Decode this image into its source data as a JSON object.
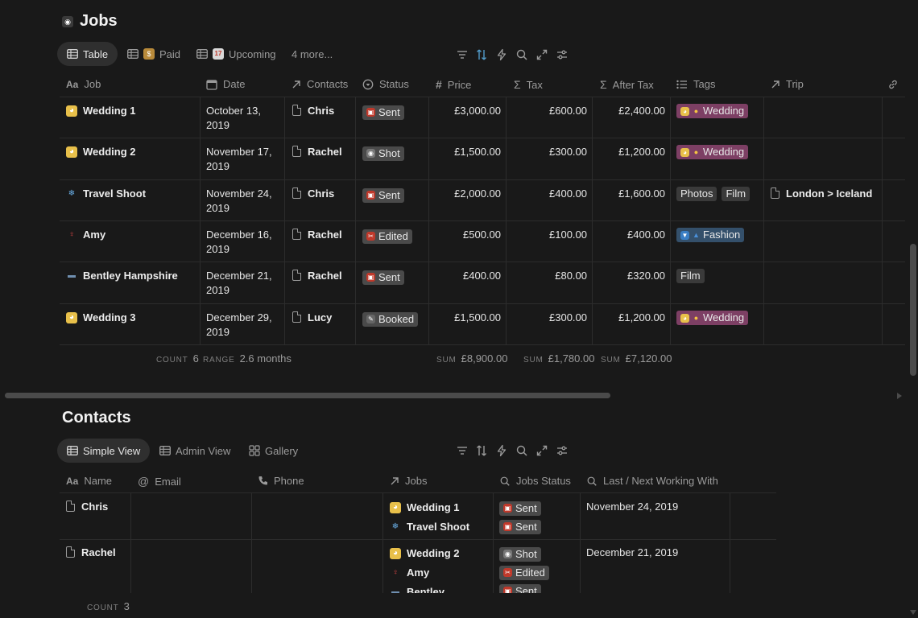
{
  "jobs": {
    "title": "Jobs",
    "icon": "camera-flash-icon",
    "tabs": [
      {
        "label": "Table",
        "icon": "table-icon",
        "emoji": ""
      },
      {
        "label": "Paid",
        "icon": "table-icon",
        "emoji": "money-bag-icon"
      },
      {
        "label": "Upcoming",
        "icon": "table-icon",
        "emoji": "calendar-icon"
      }
    ],
    "more_tabs": "4 more...",
    "columns": [
      "Job",
      "Date",
      "Contacts",
      "Status",
      "Price",
      "Tax",
      "After Tax",
      "Tags",
      "Trip"
    ],
    "rows": [
      {
        "icon": "bride-icon",
        "job": "Wedding 1",
        "date1": "October 13,",
        "date2": "2019",
        "contact": "Chris",
        "status": "Sent",
        "price": "£3,000.00",
        "tax": "£600.00",
        "after_tax": "£2,400.00",
        "tags": [
          {
            "label": "Wedding",
            "color": "pink",
            "emoji": true
          }
        ],
        "trip": ""
      },
      {
        "icon": "bride-icon",
        "job": "Wedding 2",
        "date1": "November 17,",
        "date2": "2019",
        "contact": "Rachel",
        "status": "Shot",
        "price": "£1,500.00",
        "tax": "£300.00",
        "after_tax": "£1,200.00",
        "tags": [
          {
            "label": "Wedding",
            "color": "pink",
            "emoji": true
          }
        ],
        "trip": ""
      },
      {
        "icon": "snowflake-icon",
        "job": "Travel Shoot",
        "date1": "November 24,",
        "date2": "2019",
        "contact": "Chris",
        "status": "Sent",
        "price": "£2,000.00",
        "tax": "£400.00",
        "after_tax": "£1,600.00",
        "tags": [
          {
            "label": "Photos",
            "color": "gray",
            "emoji": false
          },
          {
            "label": "Film",
            "color": "gray",
            "emoji": false
          }
        ],
        "trip": "London > Iceland"
      },
      {
        "icon": "dancer-icon",
        "job": "Amy",
        "date1": "December 16,",
        "date2": "2019",
        "contact": "Rachel",
        "status": "Edited",
        "price": "£500.00",
        "tax": "£100.00",
        "after_tax": "£400.00",
        "tags": [
          {
            "label": "Fashion",
            "color": "blue",
            "emoji": true
          }
        ],
        "trip": ""
      },
      {
        "icon": "car-icon",
        "job": "Bentley Hampshire",
        "date1": "December 21,",
        "date2": "2019",
        "contact": "Rachel",
        "status": "Sent",
        "price": "£400.00",
        "tax": "£80.00",
        "after_tax": "£320.00",
        "tags": [
          {
            "label": "Film",
            "color": "gray",
            "emoji": false
          }
        ],
        "trip": ""
      },
      {
        "icon": "bride-icon",
        "job": "Wedding 3",
        "date1": "December 29,",
        "date2": "2019",
        "contact": "Lucy",
        "status": "Booked",
        "price": "£1,500.00",
        "tax": "£300.00",
        "after_tax": "£1,200.00",
        "tags": [
          {
            "label": "Wedding",
            "color": "pink",
            "emoji": true
          }
        ],
        "trip": ""
      }
    ],
    "footer": {
      "count_label": "COUNT",
      "count": "6",
      "range_label": "RANGE",
      "range": "2.6 months",
      "sum_label": "SUM",
      "price_sum": "£8,900.00",
      "tax_sum": "£1,780.00",
      "after_tax_sum": "£7,120.00"
    }
  },
  "contacts": {
    "title": "Contacts",
    "tabs": [
      {
        "label": "Simple View",
        "icon": "table-icon"
      },
      {
        "label": "Admin View",
        "icon": "table-icon"
      },
      {
        "label": "Gallery",
        "icon": "gallery-icon"
      }
    ],
    "columns": [
      "Name",
      "Email",
      "Phone",
      "Jobs",
      "Jobs Status",
      "Last / Next Working With"
    ],
    "rows": [
      {
        "name": "Chris",
        "jobs": [
          {
            "icon": "bride-icon",
            "label": "Wedding 1"
          },
          {
            "icon": "snowflake-icon",
            "label": "Travel Shoot"
          }
        ],
        "statuses": [
          "Sent",
          "Sent"
        ],
        "last_next": "November 24, 2019"
      },
      {
        "name": "Rachel",
        "jobs": [
          {
            "icon": "bride-icon",
            "label": "Wedding 2"
          },
          {
            "icon": "dancer-icon",
            "label": "Amy"
          },
          {
            "icon": "car-icon",
            "label": "Bentley"
          }
        ],
        "statuses": [
          "Shot",
          "Edited",
          "Sent"
        ],
        "last_next": "December 21, 2019"
      }
    ],
    "footer": {
      "count_label": "COUNT",
      "count": "3"
    }
  },
  "colors": {
    "background": "#191919",
    "pill": "#4a4a4a",
    "wedding_tag": "#7d3f64",
    "fashion_tag": "#34506b",
    "accent_blue": "#529cca"
  }
}
